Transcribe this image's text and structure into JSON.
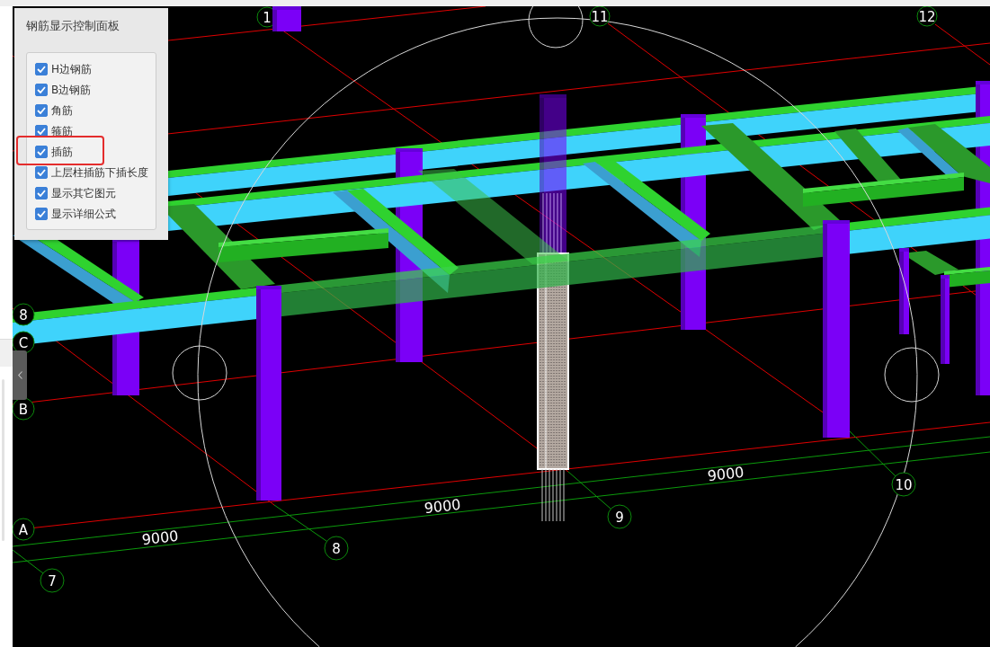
{
  "panel": {
    "title": "钢筋显示控制面板",
    "options": [
      {
        "label": "H边钢筋",
        "checked": true,
        "highlighted": false
      },
      {
        "label": "B边钢筋",
        "checked": true,
        "highlighted": false
      },
      {
        "label": "角筋",
        "checked": true,
        "highlighted": false
      },
      {
        "label": "箍筋",
        "checked": true,
        "highlighted": false
      },
      {
        "label": "插筋",
        "checked": true,
        "highlighted": true
      },
      {
        "label": "上层柱插筋下插长度",
        "checked": true,
        "highlighted": false
      },
      {
        "label": "显示其它图元",
        "checked": true,
        "highlighted": false
      },
      {
        "label": "显示详细公式",
        "checked": true,
        "highlighted": false
      }
    ]
  },
  "viewport": {
    "axis_labels": [
      "1",
      "11",
      "12",
      "8",
      "C",
      "B",
      "A",
      "7",
      "8",
      "9",
      "10"
    ],
    "dimension_labels": [
      "9000",
      "9000",
      "9000"
    ]
  }
}
